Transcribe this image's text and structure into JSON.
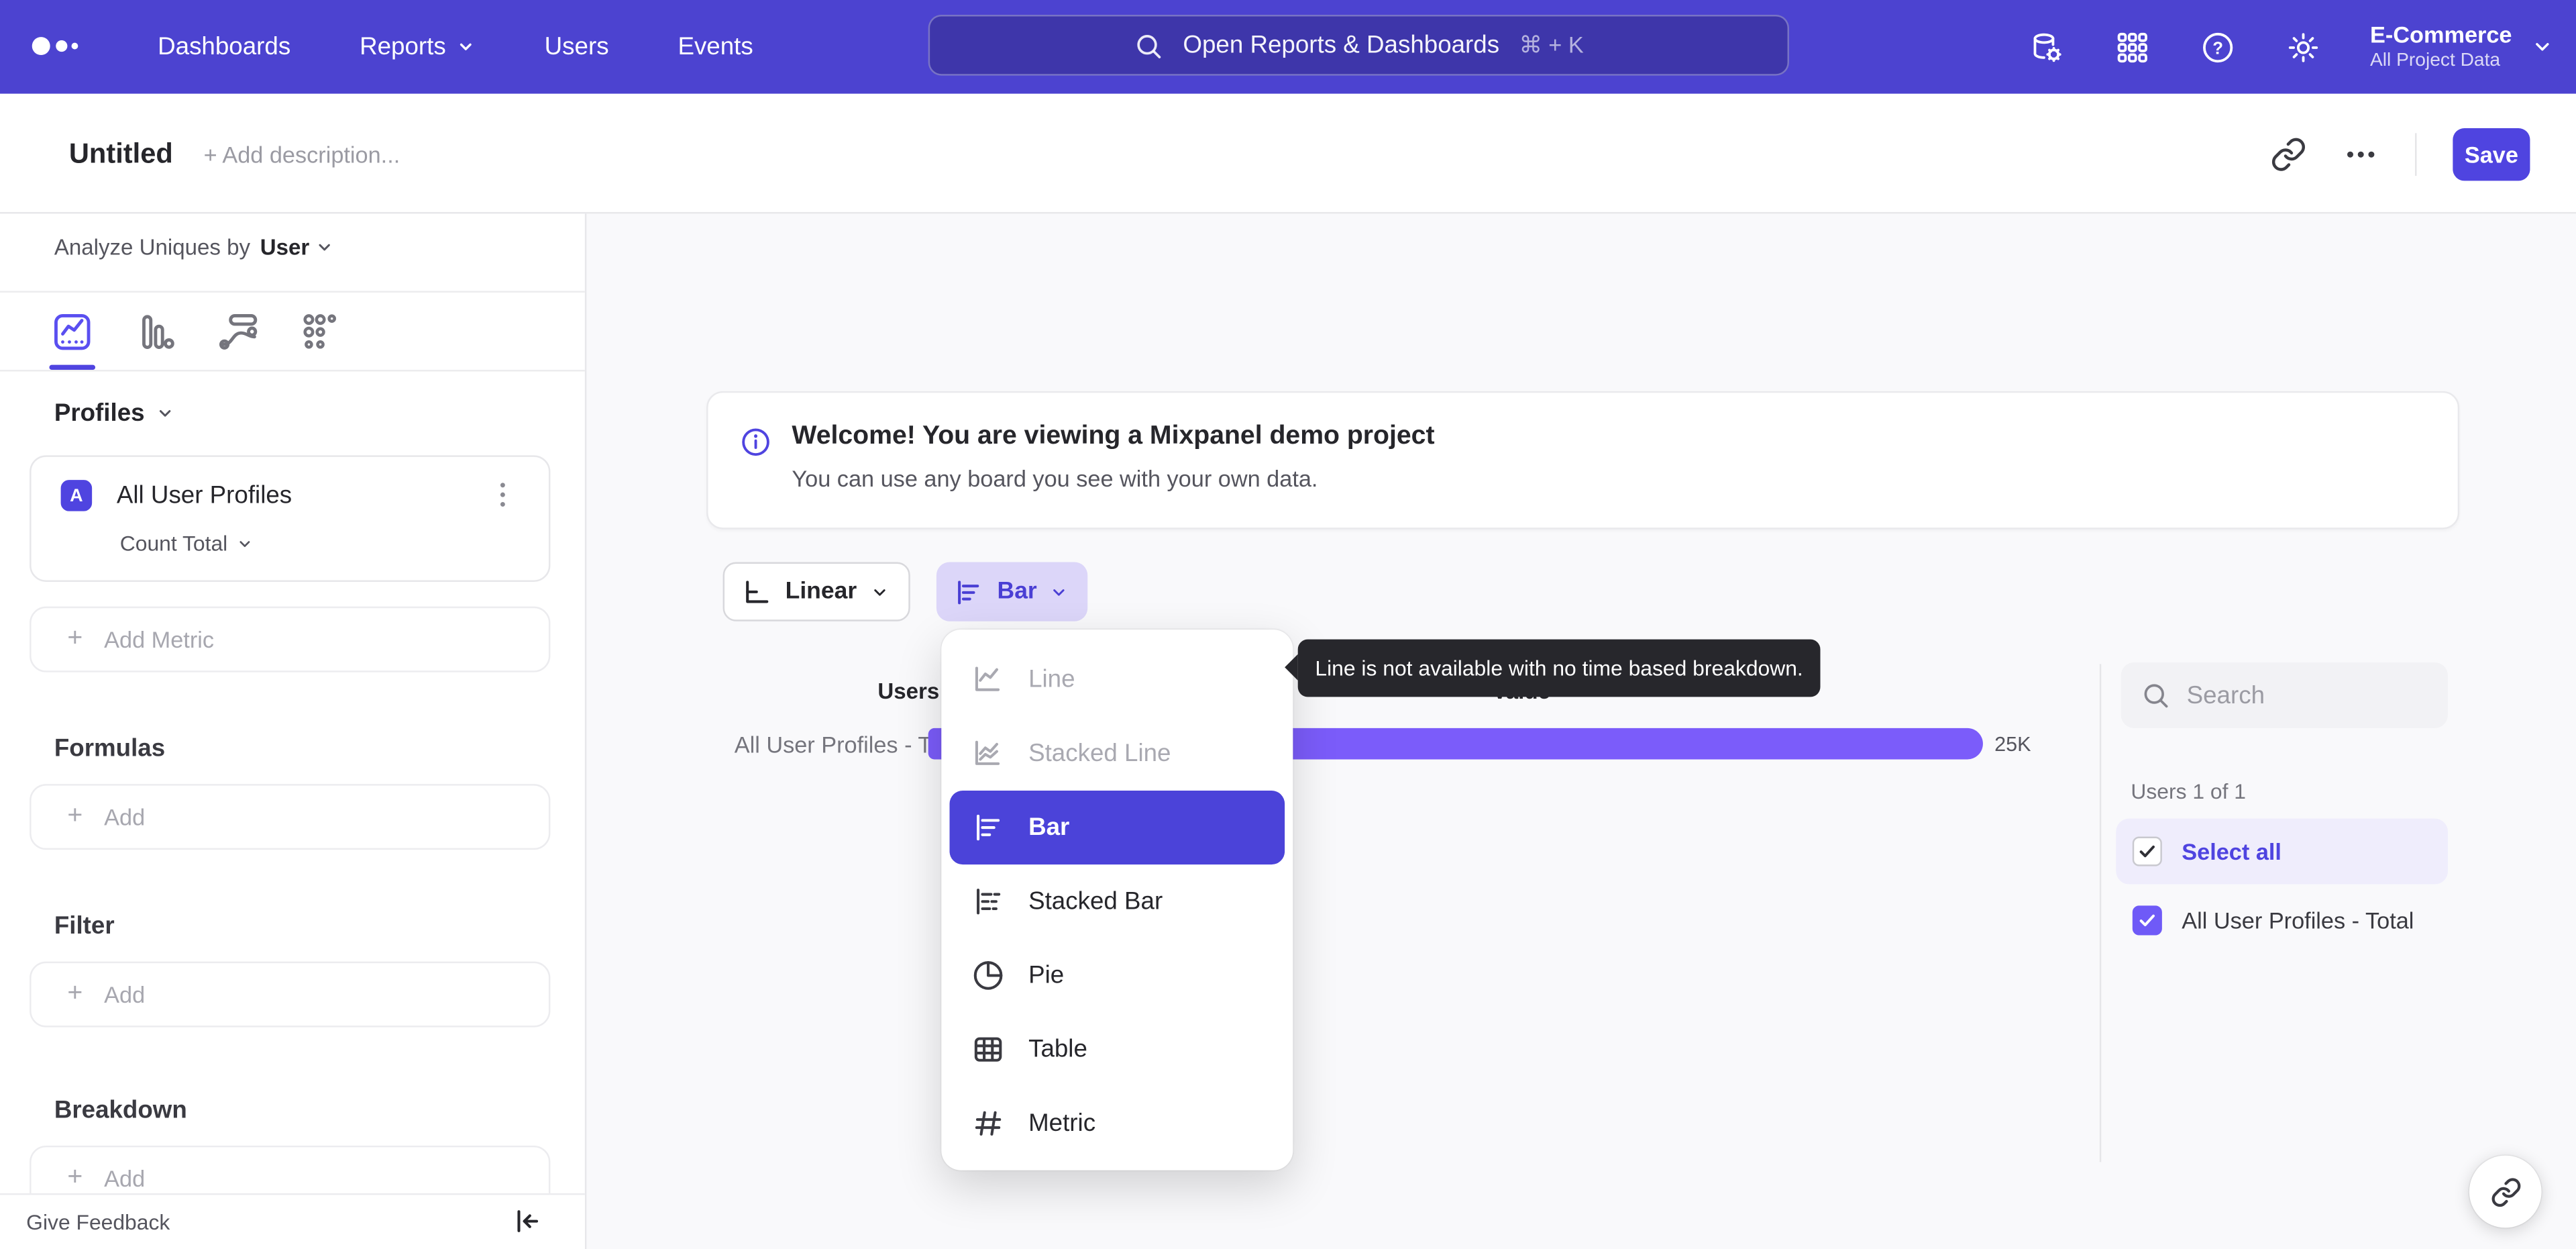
{
  "topnav": {
    "items": [
      {
        "label": "Dashboards"
      },
      {
        "label": "Reports"
      },
      {
        "label": "Users"
      },
      {
        "label": "Events"
      }
    ],
    "search": {
      "placeholder": "Open Reports & Dashboards",
      "shortcut": "⌘ + K"
    },
    "project": {
      "name": "E-Commerce",
      "scope": "All Project Data"
    }
  },
  "report_header": {
    "title": "Untitled",
    "description_placeholder": "+ Add description...",
    "save_label": "Save"
  },
  "sidebar": {
    "analyze_prefix": "Analyze Uniques by",
    "analyze_value": "User",
    "profiles_label": "Profiles",
    "metric": {
      "badge": "A",
      "name": "All User Profiles",
      "aggregation": "Count Total"
    },
    "add_metric_label": "Add Metric",
    "plus": "+",
    "sections": [
      {
        "title": "Formulas",
        "add_label": "Add"
      },
      {
        "title": "Filter",
        "add_label": "Add"
      },
      {
        "title": "Breakdown",
        "add_label": "Add"
      }
    ],
    "feedback_label": "Give Feedback"
  },
  "banner": {
    "title": "Welcome! You are viewing a Mixpanel demo project",
    "subtitle": "You can use any board you see with your own data."
  },
  "controls": {
    "scale_label": "Linear",
    "chart_type_label": "Bar"
  },
  "chart_data": {
    "type": "bar",
    "orientation": "horizontal",
    "columns": [
      "Users",
      "Value"
    ],
    "categories": [
      "All User Profiles - Total"
    ],
    "values": [
      25000
    ],
    "value_labels": [
      "25K"
    ],
    "bar_color": "#7b5cfa",
    "xlim": [
      0,
      25000
    ]
  },
  "dropdown": {
    "items": [
      {
        "label": "Line",
        "state": "disabled"
      },
      {
        "label": "Stacked Line",
        "state": "disabled"
      },
      {
        "label": "Bar",
        "state": "selected"
      },
      {
        "label": "Stacked Bar",
        "state": "normal"
      },
      {
        "label": "Pie",
        "state": "normal"
      },
      {
        "label": "Table",
        "state": "normal"
      },
      {
        "label": "Metric",
        "state": "normal"
      }
    ]
  },
  "tooltip": {
    "text": "Line is not available with no time based breakdown."
  },
  "right_panel": {
    "search_placeholder": "Search",
    "count_label": "Users 1 of 1",
    "select_all_label": "Select all",
    "rows": [
      {
        "label": "All User Profiles - Total",
        "checked": true
      }
    ]
  },
  "colors": {
    "nav": "#4c43d0",
    "accent": "#4f44e0",
    "bar": "#7b5cfa",
    "selected_menu": "#4b43d9",
    "tooltip_bg": "#27272c"
  }
}
